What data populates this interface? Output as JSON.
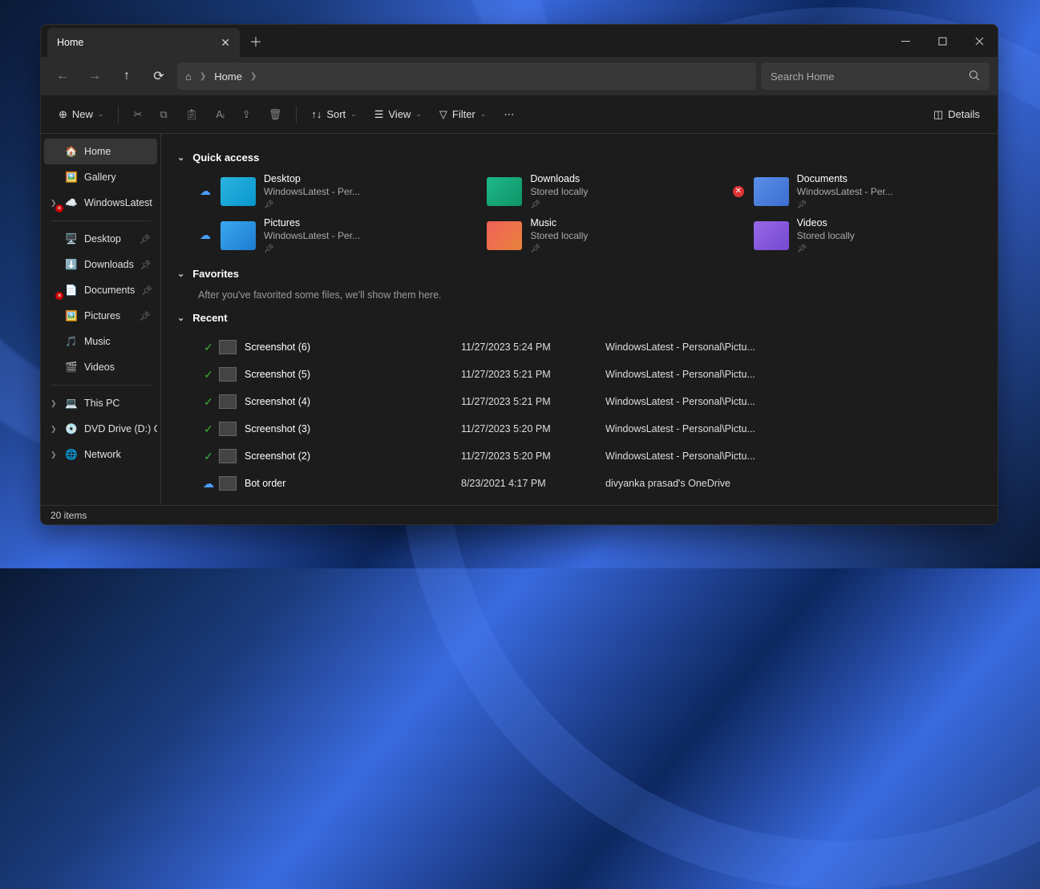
{
  "tab": {
    "title": "Home"
  },
  "breadcrumb": {
    "location": "Home"
  },
  "search": {
    "placeholder": "Search Home"
  },
  "toolbar": {
    "new": "New",
    "sort": "Sort",
    "view": "View",
    "filter": "Filter",
    "details": "Details"
  },
  "sidebar": {
    "top": [
      {
        "label": "Home",
        "icon": "home"
      },
      {
        "label": "Gallery",
        "icon": "gallery"
      },
      {
        "label": "WindowsLatest",
        "icon": "onedrive",
        "exp": true,
        "err": true
      }
    ],
    "quick": [
      {
        "label": "Desktop",
        "icon": "desktop",
        "pin": true
      },
      {
        "label": "Downloads",
        "icon": "downloads",
        "pin": true
      },
      {
        "label": "Documents",
        "icon": "documents",
        "pin": true,
        "err": true
      },
      {
        "label": "Pictures",
        "icon": "pictures",
        "pin": true
      },
      {
        "label": "Music",
        "icon": "music"
      },
      {
        "label": "Videos",
        "icon": "videos"
      }
    ],
    "bottom": [
      {
        "label": "This PC",
        "icon": "pc",
        "exp": true
      },
      {
        "label": "DVD Drive (D:) C",
        "icon": "dvd",
        "exp": true
      },
      {
        "label": "Network",
        "icon": "network",
        "exp": true
      }
    ]
  },
  "sections": {
    "quick": "Quick access",
    "favorites": "Favorites",
    "recent": "Recent"
  },
  "favorites_empty": "After you've favorited some files, we'll show them here.",
  "quick_access": [
    {
      "name": "Desktop",
      "sub": "WindowsLatest - Per...",
      "ind": "cloud",
      "fold": "f-desk"
    },
    {
      "name": "Downloads",
      "sub": "Stored locally",
      "ind": "",
      "fold": "f-down"
    },
    {
      "name": "Documents",
      "sub": "WindowsLatest - Per...",
      "ind": "err",
      "fold": "f-doc"
    },
    {
      "name": "Pictures",
      "sub": "WindowsLatest - Per...",
      "ind": "cloud",
      "fold": "f-pic"
    },
    {
      "name": "Music",
      "sub": "Stored locally",
      "ind": "",
      "fold": "f-mus"
    },
    {
      "name": "Videos",
      "sub": "Stored locally",
      "ind": "",
      "fold": "f-vid"
    }
  ],
  "recent": [
    {
      "name": "Screenshot (6)",
      "date": "11/27/2023 5:24 PM",
      "loc": "WindowsLatest - Personal\\Pictu...",
      "stat": "chk"
    },
    {
      "name": "Screenshot (5)",
      "date": "11/27/2023 5:21 PM",
      "loc": "WindowsLatest - Personal\\Pictu...",
      "stat": "chk"
    },
    {
      "name": "Screenshot (4)",
      "date": "11/27/2023 5:21 PM",
      "loc": "WindowsLatest - Personal\\Pictu...",
      "stat": "chk"
    },
    {
      "name": "Screenshot (3)",
      "date": "11/27/2023 5:20 PM",
      "loc": "WindowsLatest - Personal\\Pictu...",
      "stat": "chk"
    },
    {
      "name": "Screenshot (2)",
      "date": "11/27/2023 5:20 PM",
      "loc": "WindowsLatest - Personal\\Pictu...",
      "stat": "chk"
    },
    {
      "name": "Bot order",
      "date": "8/23/2021 4:17 PM",
      "loc": "divyanka prasad's OneDrive",
      "stat": "cloud"
    }
  ],
  "status": "20 items"
}
